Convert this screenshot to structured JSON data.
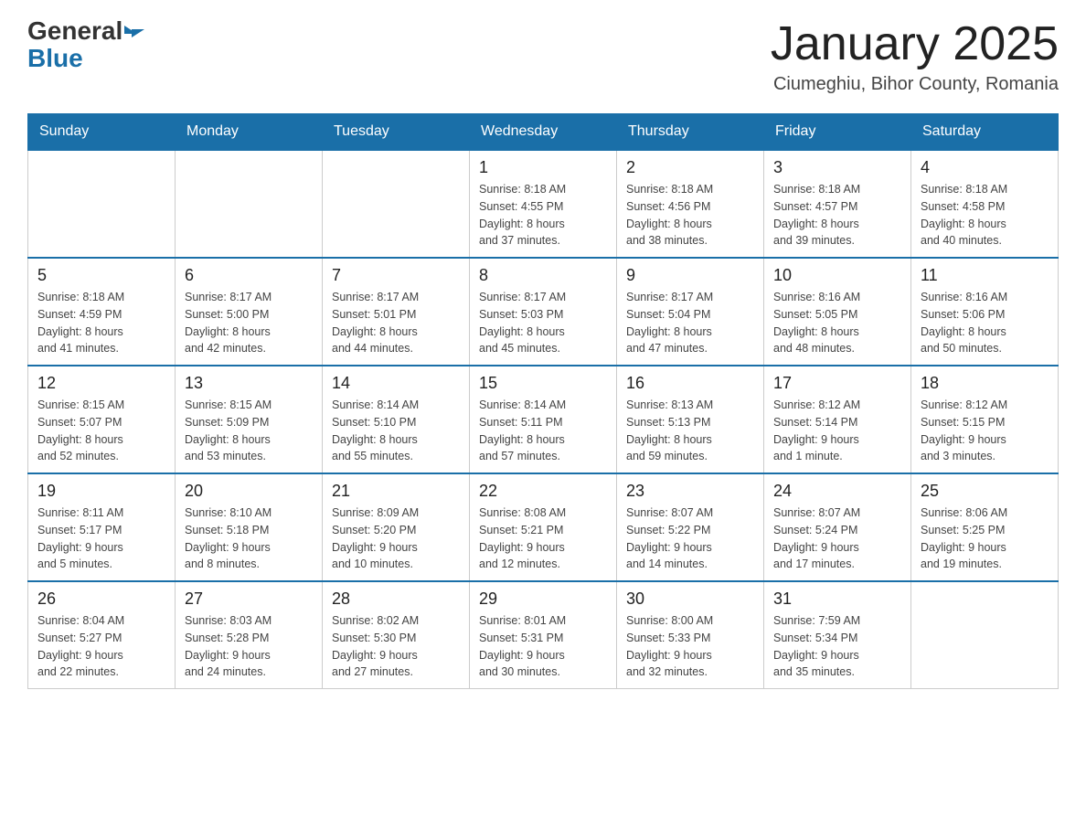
{
  "logo": {
    "general": "General",
    "blue": "Blue"
  },
  "title": {
    "month_year": "January 2025",
    "location": "Ciumeghiu, Bihor County, Romania"
  },
  "headers": [
    "Sunday",
    "Monday",
    "Tuesday",
    "Wednesday",
    "Thursday",
    "Friday",
    "Saturday"
  ],
  "weeks": [
    [
      {
        "day": "",
        "info": ""
      },
      {
        "day": "",
        "info": ""
      },
      {
        "day": "",
        "info": ""
      },
      {
        "day": "1",
        "info": "Sunrise: 8:18 AM\nSunset: 4:55 PM\nDaylight: 8 hours\nand 37 minutes."
      },
      {
        "day": "2",
        "info": "Sunrise: 8:18 AM\nSunset: 4:56 PM\nDaylight: 8 hours\nand 38 minutes."
      },
      {
        "day": "3",
        "info": "Sunrise: 8:18 AM\nSunset: 4:57 PM\nDaylight: 8 hours\nand 39 minutes."
      },
      {
        "day": "4",
        "info": "Sunrise: 8:18 AM\nSunset: 4:58 PM\nDaylight: 8 hours\nand 40 minutes."
      }
    ],
    [
      {
        "day": "5",
        "info": "Sunrise: 8:18 AM\nSunset: 4:59 PM\nDaylight: 8 hours\nand 41 minutes."
      },
      {
        "day": "6",
        "info": "Sunrise: 8:17 AM\nSunset: 5:00 PM\nDaylight: 8 hours\nand 42 minutes."
      },
      {
        "day": "7",
        "info": "Sunrise: 8:17 AM\nSunset: 5:01 PM\nDaylight: 8 hours\nand 44 minutes."
      },
      {
        "day": "8",
        "info": "Sunrise: 8:17 AM\nSunset: 5:03 PM\nDaylight: 8 hours\nand 45 minutes."
      },
      {
        "day": "9",
        "info": "Sunrise: 8:17 AM\nSunset: 5:04 PM\nDaylight: 8 hours\nand 47 minutes."
      },
      {
        "day": "10",
        "info": "Sunrise: 8:16 AM\nSunset: 5:05 PM\nDaylight: 8 hours\nand 48 minutes."
      },
      {
        "day": "11",
        "info": "Sunrise: 8:16 AM\nSunset: 5:06 PM\nDaylight: 8 hours\nand 50 minutes."
      }
    ],
    [
      {
        "day": "12",
        "info": "Sunrise: 8:15 AM\nSunset: 5:07 PM\nDaylight: 8 hours\nand 52 minutes."
      },
      {
        "day": "13",
        "info": "Sunrise: 8:15 AM\nSunset: 5:09 PM\nDaylight: 8 hours\nand 53 minutes."
      },
      {
        "day": "14",
        "info": "Sunrise: 8:14 AM\nSunset: 5:10 PM\nDaylight: 8 hours\nand 55 minutes."
      },
      {
        "day": "15",
        "info": "Sunrise: 8:14 AM\nSunset: 5:11 PM\nDaylight: 8 hours\nand 57 minutes."
      },
      {
        "day": "16",
        "info": "Sunrise: 8:13 AM\nSunset: 5:13 PM\nDaylight: 8 hours\nand 59 minutes."
      },
      {
        "day": "17",
        "info": "Sunrise: 8:12 AM\nSunset: 5:14 PM\nDaylight: 9 hours\nand 1 minute."
      },
      {
        "day": "18",
        "info": "Sunrise: 8:12 AM\nSunset: 5:15 PM\nDaylight: 9 hours\nand 3 minutes."
      }
    ],
    [
      {
        "day": "19",
        "info": "Sunrise: 8:11 AM\nSunset: 5:17 PM\nDaylight: 9 hours\nand 5 minutes."
      },
      {
        "day": "20",
        "info": "Sunrise: 8:10 AM\nSunset: 5:18 PM\nDaylight: 9 hours\nand 8 minutes."
      },
      {
        "day": "21",
        "info": "Sunrise: 8:09 AM\nSunset: 5:20 PM\nDaylight: 9 hours\nand 10 minutes."
      },
      {
        "day": "22",
        "info": "Sunrise: 8:08 AM\nSunset: 5:21 PM\nDaylight: 9 hours\nand 12 minutes."
      },
      {
        "day": "23",
        "info": "Sunrise: 8:07 AM\nSunset: 5:22 PM\nDaylight: 9 hours\nand 14 minutes."
      },
      {
        "day": "24",
        "info": "Sunrise: 8:07 AM\nSunset: 5:24 PM\nDaylight: 9 hours\nand 17 minutes."
      },
      {
        "day": "25",
        "info": "Sunrise: 8:06 AM\nSunset: 5:25 PM\nDaylight: 9 hours\nand 19 minutes."
      }
    ],
    [
      {
        "day": "26",
        "info": "Sunrise: 8:04 AM\nSunset: 5:27 PM\nDaylight: 9 hours\nand 22 minutes."
      },
      {
        "day": "27",
        "info": "Sunrise: 8:03 AM\nSunset: 5:28 PM\nDaylight: 9 hours\nand 24 minutes."
      },
      {
        "day": "28",
        "info": "Sunrise: 8:02 AM\nSunset: 5:30 PM\nDaylight: 9 hours\nand 27 minutes."
      },
      {
        "day": "29",
        "info": "Sunrise: 8:01 AM\nSunset: 5:31 PM\nDaylight: 9 hours\nand 30 minutes."
      },
      {
        "day": "30",
        "info": "Sunrise: 8:00 AM\nSunset: 5:33 PM\nDaylight: 9 hours\nand 32 minutes."
      },
      {
        "day": "31",
        "info": "Sunrise: 7:59 AM\nSunset: 5:34 PM\nDaylight: 9 hours\nand 35 minutes."
      },
      {
        "day": "",
        "info": ""
      }
    ]
  ]
}
